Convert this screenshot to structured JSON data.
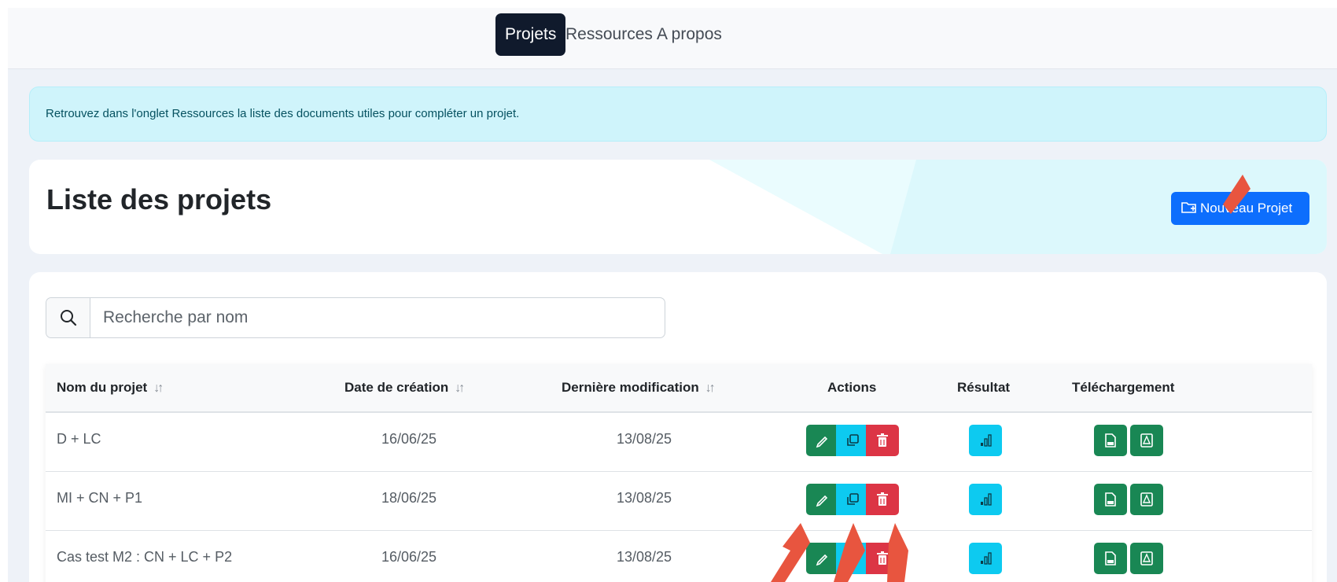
{
  "nav": {
    "items": [
      "Projets",
      "Ressources",
      "A propos"
    ],
    "active": "Projets"
  },
  "alert": {
    "text": "Retrouvez dans l'onglet Ressources la liste des documents utiles pour compléter un projet."
  },
  "header": {
    "title": "Liste des projets",
    "new_button_label": "Nouveau Projet",
    "new_button_icon": "folder-plus-icon"
  },
  "search": {
    "placeholder": "Recherche par nom",
    "value": "",
    "icon": "search-icon"
  },
  "table": {
    "columns": [
      {
        "label": "Nom du projet",
        "sortable": true
      },
      {
        "label": "Date de création",
        "sortable": true
      },
      {
        "label": "Dernière modification",
        "sortable": true
      },
      {
        "label": "Actions",
        "sortable": false
      },
      {
        "label": "Résultat",
        "sortable": false
      },
      {
        "label": "Téléchargement",
        "sortable": false
      }
    ],
    "sort_icon": "↓↑",
    "rows": [
      {
        "name": "D + LC",
        "created": "16/06/25",
        "modified": "13/08/25"
      },
      {
        "name": "MI + CN + P1",
        "created": "18/06/25",
        "modified": "13/08/25"
      },
      {
        "name": "Cas test M2 : CN + LC + P2",
        "created": "16/06/25",
        "modified": "13/08/25"
      }
    ],
    "action_icons": [
      "pencil-icon",
      "copy-icon",
      "trash-icon"
    ],
    "result_icon": "bar-chart-icon",
    "download_icons": [
      "file-spreadsheet-icon",
      "file-pdf-icon"
    ]
  },
  "colors": {
    "navbar_bg": "#f8f9fb",
    "nav_active_bg": "#101a2c",
    "page_bg": "#eef2f8",
    "alert_bg": "#cff4fb",
    "alert_text": "#055160",
    "primary": "#0d6efd",
    "success": "#198754",
    "info": "#0dcaf0",
    "danger": "#dc3545",
    "annotation_arrow": "#e8553f"
  }
}
